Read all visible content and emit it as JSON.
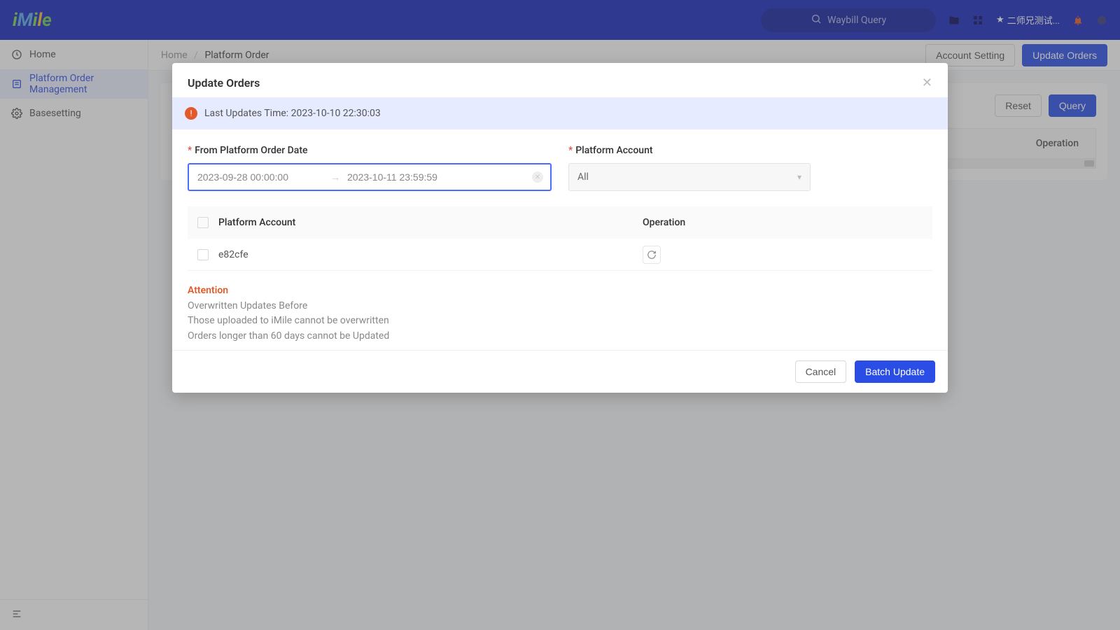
{
  "brand": {
    "name": "iMile"
  },
  "topbar": {
    "search_placeholder": "Waybill Query",
    "user_label": "二师兄测试..."
  },
  "sidebar": {
    "items": [
      {
        "label": "Home"
      },
      {
        "label": "Platform Order Management"
      },
      {
        "label": "Basesetting"
      }
    ]
  },
  "breadcrumb": {
    "root": "Home",
    "current": "Platform Order",
    "buttons": {
      "account_setting": "Account Setting",
      "update_orders": "Update Orders"
    }
  },
  "page": {
    "reset": "Reset",
    "query": "Query",
    "col_operation": "Operation"
  },
  "modal": {
    "title": "Update Orders",
    "last_update_prefix": "Last Updates Time: ",
    "last_update_value": "2023-10-10 22:30:03",
    "date_label": "From Platform Order Date",
    "date_from": "2023-09-28 00:00:00",
    "date_to": "2023-10-11 23:59:59",
    "account_label": "Platform Account",
    "account_value": "All",
    "table": {
      "col_account": "Platform Account",
      "col_operation": "Operation",
      "rows": [
        {
          "account": "e82cfe"
        }
      ]
    },
    "attention": {
      "title": "Attention",
      "lines": [
        "Overwritten Updates Before",
        "Those uploaded to iMile cannot be overwritten",
        "Orders longer than 60 days cannot be Updated"
      ]
    },
    "buttons": {
      "cancel": "Cancel",
      "batch_update": "Batch Update"
    }
  }
}
